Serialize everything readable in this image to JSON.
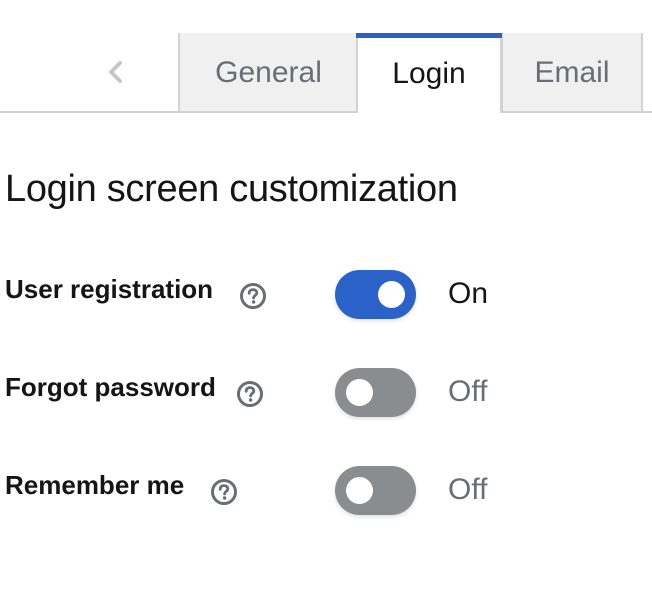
{
  "tabs": [
    {
      "label": "General",
      "active": false
    },
    {
      "label": "Login",
      "active": true
    },
    {
      "label": "Email",
      "active": false
    }
  ],
  "section": {
    "title": "Login screen customization"
  },
  "settings": [
    {
      "label": "User registration",
      "state": "On",
      "enabled": true
    },
    {
      "label": "Forgot password",
      "state": "Off",
      "enabled": false
    },
    {
      "label": "Remember me",
      "state": "Off",
      "enabled": false
    }
  ],
  "icons": {
    "scroll_prev": "chevron-left-icon",
    "help": "question-circle-icon"
  },
  "colors": {
    "accent": "#2b62c9",
    "switch_off": "#8a8d90",
    "tab_inactive_bg": "#f0f0f0"
  }
}
